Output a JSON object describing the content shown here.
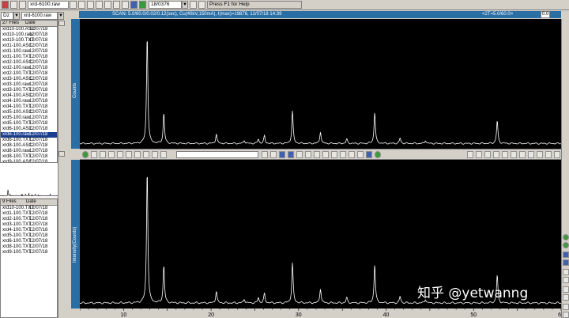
{
  "toolbar": {
    "file_combo": "18/0376",
    "help_text": "Press F1 for Help",
    "drive": "Dz",
    "file_name": "xrd-6100.raw"
  },
  "scan_bar": {
    "info": "SCAN: 5.0/60.0/0.02/0.12(sec), Cu(40kV,150mA), I(max)=19876, 12/07/18 14:39",
    "cursor": "<2T=5.0/60.0>",
    "zoom": "0.0"
  },
  "file_panel": {
    "count_label": "27 Files",
    "date_header": "Date",
    "files": [
      {
        "name": "xrd10-100.ASC",
        "date": "12/07/18"
      },
      {
        "name": "xrd10-100.raw",
        "date": "12/07/18"
      },
      {
        "name": "xrd10-100.TXT",
        "date": "12/07/18"
      },
      {
        "name": "xrd1-100.ASC",
        "date": "12/07/18"
      },
      {
        "name": "xrd1-100.raw",
        "date": "12/07/18"
      },
      {
        "name": "xrd1-100.TXT",
        "date": "12/07/18"
      },
      {
        "name": "xrd2-100.ASC",
        "date": "12/07/18"
      },
      {
        "name": "xrd2-100.raw",
        "date": "12/07/18"
      },
      {
        "name": "xrd2-100.TXT",
        "date": "12/07/18"
      },
      {
        "name": "xrd3-100.ASC",
        "date": "12/07/18"
      },
      {
        "name": "xrd3-100.raw",
        "date": "12/07/18"
      },
      {
        "name": "xrd3-100.TXT",
        "date": "12/07/18"
      },
      {
        "name": "xrd4-100.ASC",
        "date": "12/07/18"
      },
      {
        "name": "xrd4-100.raw",
        "date": "12/07/18"
      },
      {
        "name": "xrd4-100.TXT",
        "date": "12/07/18"
      },
      {
        "name": "xrd5-100.ASC",
        "date": "12/07/18"
      },
      {
        "name": "xrd5-100.raw",
        "date": "12/07/18"
      },
      {
        "name": "xrd5-100.TXT",
        "date": "12/07/18"
      },
      {
        "name": "xrd6-100.ASC",
        "date": "12/07/18"
      },
      {
        "name": "xrd6-100.raw",
        "date": "12/07/18",
        "selected": true
      },
      {
        "name": "xrd6-100.TXT",
        "date": "12/07/18"
      },
      {
        "name": "xrd8-100.ASC",
        "date": "12/07/18"
      },
      {
        "name": "xrd8-100.raw",
        "date": "12/07/18"
      },
      {
        "name": "xrd8-100.TXT",
        "date": "12/07/18"
      },
      {
        "name": "xrd9-100.ASC",
        "date": "12/07/18"
      }
    ]
  },
  "file_panel2": {
    "count_label": "9 Files",
    "date_header": "Date",
    "files": [
      {
        "name": "xrd10-100.TXT",
        "date": "12/07/18"
      },
      {
        "name": "xrd1-100.TXT",
        "date": "12/07/18"
      },
      {
        "name": "xrd2-100.TXT",
        "date": "12/07/18"
      },
      {
        "name": "xrd3-100.TXT",
        "date": "12/07/18"
      },
      {
        "name": "xrd4-100.TXT",
        "date": "12/07/18"
      },
      {
        "name": "xrd5-100.TXT",
        "date": "12/07/18"
      },
      {
        "name": "xrd6-100.TXT",
        "date": "12/07/18"
      },
      {
        "name": "xrd8-100.TXT",
        "date": "12/07/18"
      },
      {
        "name": "xrd9-100.TXT",
        "date": "12/07/18"
      }
    ]
  },
  "plots": {
    "top_ylabel": "Counts",
    "bottom_ylabel": "Intensity(Counts)",
    "x_ticks": [
      "10",
      "20",
      "30",
      "40",
      "50",
      "60"
    ]
  },
  "watermark": "知乎 @yetwanng",
  "chart_data": {
    "type": "line",
    "x_range": [
      5,
      60
    ],
    "peaks": [
      {
        "x": 12.7,
        "y": 1.0
      },
      {
        "x": 14.6,
        "y": 0.28
      },
      {
        "x": 20.6,
        "y": 0.09
      },
      {
        "x": 23.8,
        "y": 0.03
      },
      {
        "x": 25.4,
        "y": 0.04
      },
      {
        "x": 26.1,
        "y": 0.07
      },
      {
        "x": 29.3,
        "y": 0.3
      },
      {
        "x": 32.5,
        "y": 0.11
      },
      {
        "x": 35.5,
        "y": 0.04
      },
      {
        "x": 38.7,
        "y": 0.29
      },
      {
        "x": 41.6,
        "y": 0.05
      },
      {
        "x": 44.5,
        "y": 0.03
      },
      {
        "x": 52.7,
        "y": 0.21
      }
    ],
    "colors": {
      "trace": "#ffffff",
      "background": "#000000"
    }
  }
}
